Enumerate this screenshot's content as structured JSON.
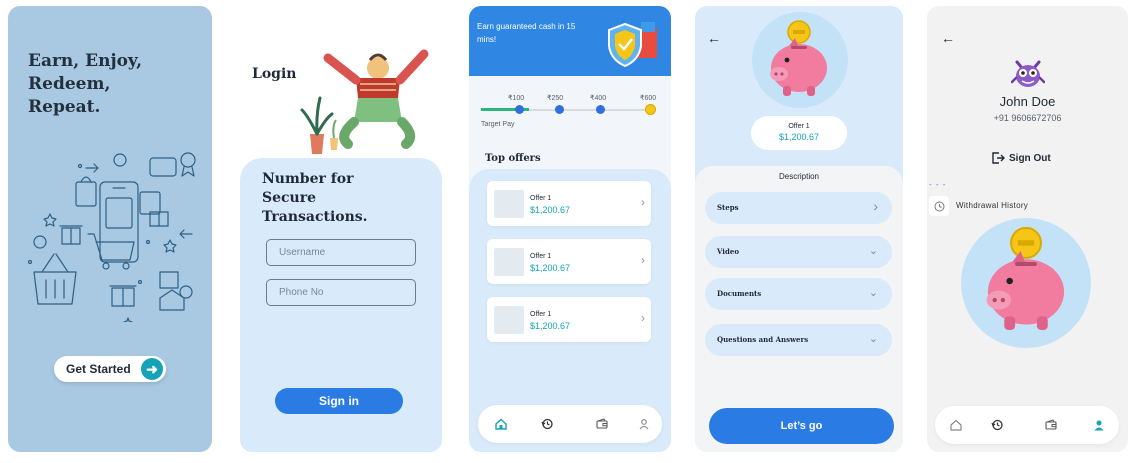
{
  "screen1": {
    "headline": "Earn, Enjoy,\nRedeem,\nRepeat.",
    "get_started": "Get Started",
    "arrow_icon": "arrow-right-icon"
  },
  "screen2": {
    "login_title": "Login",
    "card_title": "Number for\nSecure\nTransactions.",
    "username_placeholder": "Username",
    "phone_placeholder": "Phone No",
    "sign_in": "Sign in"
  },
  "screen3": {
    "banner_text": "Earn guaranteed cash in 15 mins!",
    "milestones": [
      "₹100",
      "₹250",
      "₹400",
      "₹600"
    ],
    "target_label": "Target Pay",
    "progress_fraction": 0.25,
    "top_offers_title": "Top offers",
    "offers": [
      {
        "title": "Offer 1",
        "amount": "$1,200.67"
      },
      {
        "title": "Offer 1",
        "amount": "$1,200.67"
      },
      {
        "title": "Offer 1",
        "amount": "$1,200.67"
      }
    ],
    "nav_icons": [
      "home-icon",
      "history-icon",
      "wallet-icon",
      "user-icon"
    ]
  },
  "screen4": {
    "offer_title": "Offer 1",
    "offer_amount": "$1,200.67",
    "description_title": "Description",
    "sections": [
      "Steps",
      "Video",
      "Documents",
      "Questions and Answers"
    ],
    "cta": "Let’s go"
  },
  "screen5": {
    "name": "John Doe",
    "phone": "+91 9606672706",
    "sign_out": "Sign Out",
    "withdrawal_history": "Withdrawal History",
    "nav_icons": [
      "home-icon",
      "history-icon",
      "wallet-icon",
      "user-icon"
    ]
  },
  "colors": {
    "primary_blue": "#2a7be4",
    "teal": "#14a3b8",
    "light_blue_bg": "#d9ebfa",
    "onboarding_bg": "#a9c9e2",
    "pig_pink": "#f27ba0",
    "coin_gold": "#f5c518"
  }
}
